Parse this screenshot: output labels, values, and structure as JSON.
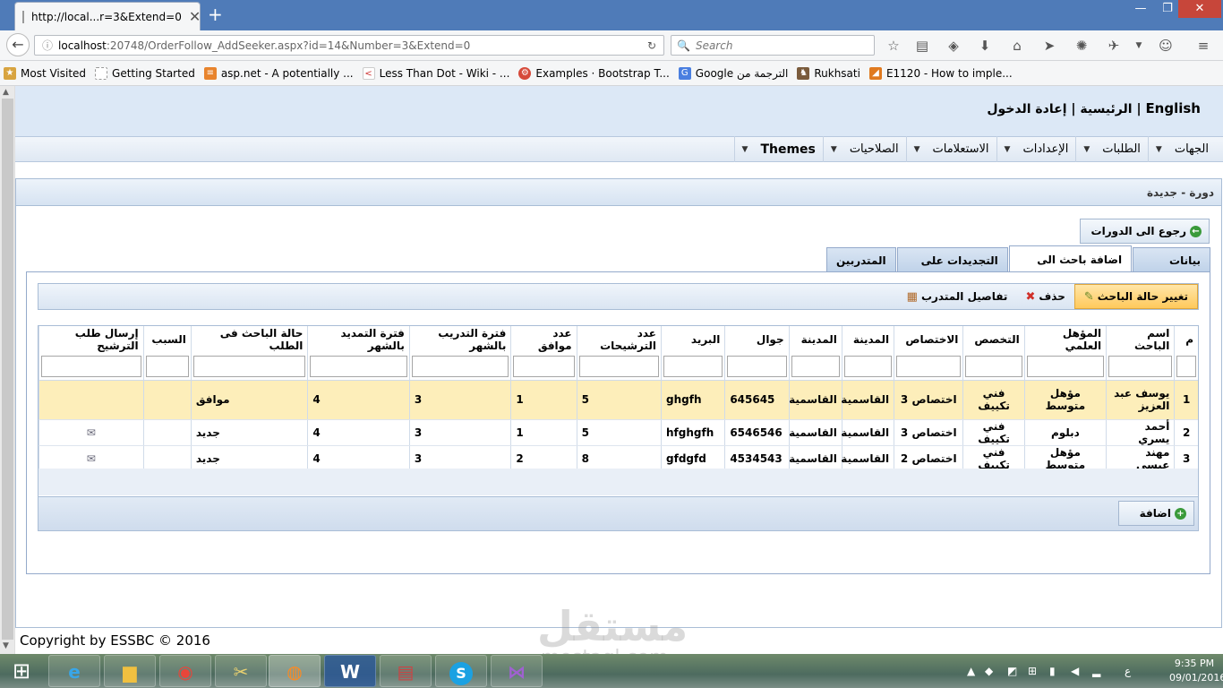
{
  "browser": {
    "tab_title": "http://local...r=3&Extend=0",
    "url_host": "localhost",
    "url_rest": ":20748/OrderFollow_AddSeeker.aspx?id=14&Number=3&Extend=0",
    "search_placeholder": "Search",
    "bookmarks": [
      {
        "label": "Most Visited",
        "icon": "bookmark-icon"
      },
      {
        "label": "Getting Started",
        "icon": "page-icon"
      },
      {
        "label": "asp.net - A potentially ...",
        "icon": "stackoverflow-icon"
      },
      {
        "label": "Less Than Dot - Wiki - ...",
        "icon": "ltd-icon"
      },
      {
        "label": "Examples · Bootstrap T...",
        "icon": "code-icon"
      },
      {
        "label": "Google الترجمة من",
        "icon": "translate-icon"
      },
      {
        "label": "Rukhsati",
        "icon": "shield-icon"
      },
      {
        "label": "E1120 - How to imple...",
        "icon": "devexpress-icon"
      }
    ]
  },
  "site": {
    "top_links": {
      "english": "English",
      "sep": "|",
      "home": "الرئيسية",
      "login": "إعادة الدخول"
    },
    "menu": [
      "الجهات",
      "الطلبات",
      "الإعدادات",
      "الاستعلامات",
      "الصلاحيات",
      "Themes"
    ],
    "panel_title": "دورة - جديدة",
    "back_button": "رجوع الى الدورات",
    "tabs": [
      "بيانات الطلب",
      "اضافة باحث الى الطلب",
      "التجديدات على العقد",
      "المتدربين"
    ],
    "active_tab": "اضافة باحث الى الطلب",
    "toolbar": {
      "change_status": "تغيير حالة الباحث",
      "delete": "حذف",
      "trainee_details": "تفاصيل المتدرب"
    },
    "grid": {
      "columns": [
        "م",
        "اسم الباحث",
        "المؤهل العلمي",
        "التخصص",
        "الاختصاص",
        "المدينة",
        "المدينة",
        "جوال",
        "البريد",
        "عدد الترشيحات",
        "عدد موافق",
        "فترة التدريب بالشهر",
        "فترة التمديد بالشهر",
        "حالة الباحث فى الطلب",
        "السبب",
        "إرسال طلب الترشيح"
      ],
      "rows": [
        {
          "n": "1",
          "name": "يوسف عبد العزيز",
          "qual": "مؤهل متوسط",
          "spec": "فني تكييف",
          "sub": "اختصاص 3",
          "city1": "القاسمية",
          "city2": "القاسمية",
          "mobile": "645645",
          "mail": "ghgfh",
          "noms": "5",
          "agree": "1",
          "train": "3",
          "extend": "4",
          "status": "موافق",
          "reason": "",
          "send": ""
        },
        {
          "n": "2",
          "name": "أحمد يسري",
          "qual": "دبلوم",
          "spec": "فني تكييف",
          "sub": "اختصاص 3",
          "city1": "القاسمية",
          "city2": "القاسمية",
          "mobile": "6546546",
          "mail": "hfghgfh",
          "noms": "5",
          "agree": "1",
          "train": "3",
          "extend": "4",
          "status": "جديد",
          "reason": "",
          "send": "✉"
        },
        {
          "n": "3",
          "name": "مهند عيسى",
          "qual": "مؤهل متوسط",
          "spec": "فني تكييف",
          "sub": "اختصاص 2",
          "city1": "القاسمية",
          "city2": "القاسمية",
          "mobile": "4534543",
          "mail": "gfdgfd",
          "noms": "8",
          "agree": "2",
          "train": "3",
          "extend": "4",
          "status": "جديد",
          "reason": "",
          "send": "✉"
        }
      ]
    },
    "add_button": "اضافة",
    "footer": "Copyright by ESSBC © 2016"
  },
  "watermark": {
    "main": "مستقل",
    "sub": "mostaql.com"
  },
  "taskbar": {
    "apps": [
      "ie-icon",
      "explorer-icon",
      "chrome-icon",
      "tools-icon",
      "firefox-icon",
      "word-icon",
      "filezilla-icon",
      "skype-icon",
      "visualstudio-icon"
    ],
    "time": "9:35 PM",
    "date": "09/01/2016",
    "lang": "ع"
  }
}
